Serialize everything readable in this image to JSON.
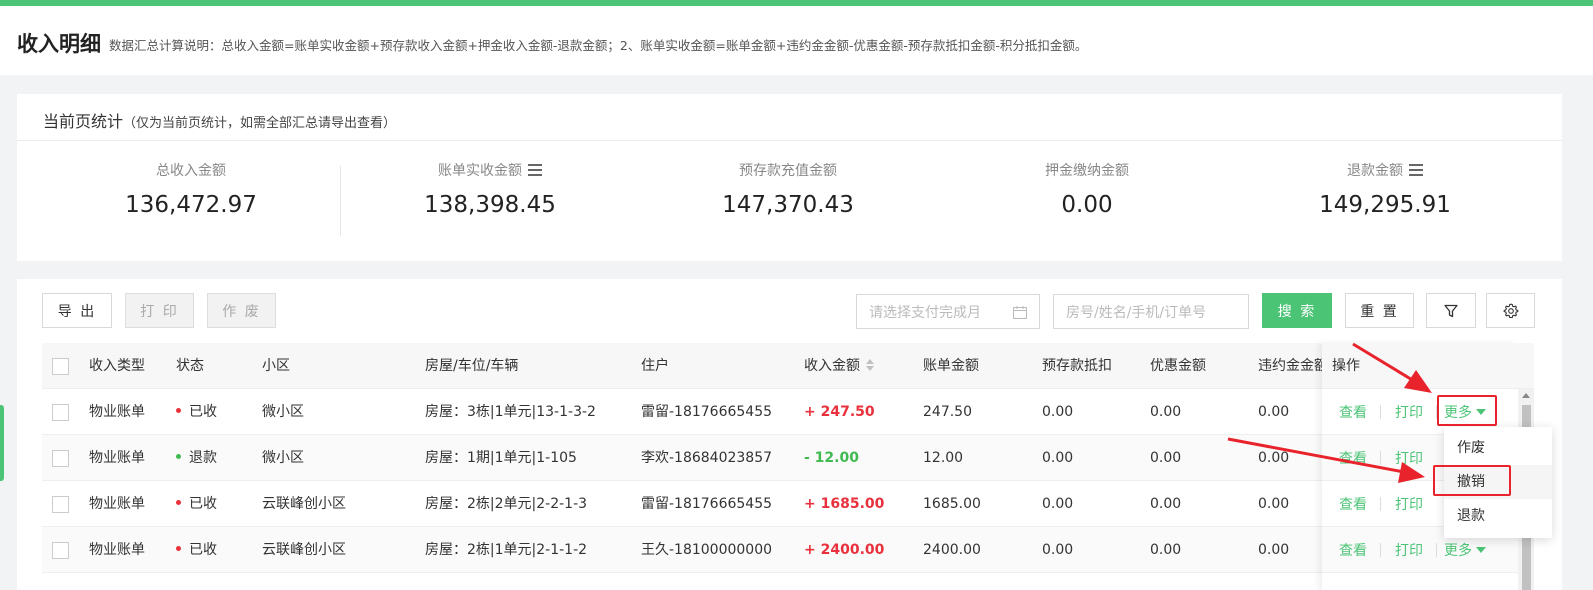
{
  "header": {
    "title": "收入明细",
    "description": "数据汇总计算说明：总收入金额=账单实收金额+预存款收入金额+押金收入金额-退款金额；2、账单实收金额=账单金额+违约金金额-优惠金额-预存款抵扣金额-积分抵扣金额。"
  },
  "stats": {
    "title": "当前页统计",
    "subtitle": "（仅为当前页统计，如需全部汇总请导出查看）",
    "items": [
      {
        "label": "总收入金额",
        "value": "136,472.97"
      },
      {
        "label": "账单实收金额",
        "value": "138,398.45"
      },
      {
        "label": "预存款充值金额",
        "value": "147,370.43"
      },
      {
        "label": "押金缴纳金额",
        "value": "0.00"
      },
      {
        "label": "退款金额",
        "value": "149,295.91"
      }
    ]
  },
  "toolbar": {
    "export": "导 出",
    "print": "打 印",
    "void": "作 废",
    "month_placeholder": "请选择支付完成月",
    "search_placeholder": "房号/姓名/手机/订单号",
    "search": "搜 索",
    "reset": "重 置"
  },
  "table": {
    "columns": [
      "收入类型",
      "状态",
      "小区",
      "房屋/车位/车辆",
      "住户",
      "收入金额",
      "账单金额",
      "预存款抵扣",
      "优惠金额",
      "违约金金额",
      "操作"
    ],
    "rows": [
      {
        "type": "物业账单",
        "status": "已收",
        "status_color": "#e8313c",
        "community": "微小区",
        "house": "房屋：3栋|1单元|13-1-3-2",
        "resident": "雷留-18176665455",
        "income": "+ 247.50",
        "income_color": "red",
        "bill": "247.50",
        "prepay": "0.00",
        "discount": "0.00",
        "penalty": "0.00"
      },
      {
        "type": "物业账单",
        "status": "退款",
        "status_color": "#3fb950",
        "community": "微小区",
        "house": "房屋：1期|1单元|1-105",
        "resident": "李欢-18684023857",
        "income": "- 12.00",
        "income_color": "green",
        "bill": "12.00",
        "prepay": "0.00",
        "discount": "0.00",
        "penalty": "0.00"
      },
      {
        "type": "物业账单",
        "status": "已收",
        "status_color": "#e8313c",
        "community": "云联峰创小区",
        "house": "房屋：2栋|2单元|2-2-1-3",
        "resident": "雷留-18176665455",
        "income": "+ 1685.00",
        "income_color": "red",
        "bill": "1685.00",
        "prepay": "0.00",
        "discount": "0.00",
        "penalty": "0.00"
      },
      {
        "type": "物业账单",
        "status": "已收",
        "status_color": "#e8313c",
        "community": "云联峰创小区",
        "house": "房屋：2栋|1单元|2-1-1-2",
        "resident": "王久-18100000000",
        "income": "+ 2400.00",
        "income_color": "red",
        "bill": "2400.00",
        "prepay": "0.00",
        "discount": "0.00",
        "penalty": "0.00"
      }
    ],
    "ops": {
      "view": "查看",
      "print": "打印",
      "more": "更多"
    }
  },
  "dropdown": {
    "items": [
      "作废",
      "撤销",
      "退款"
    ]
  },
  "colors": {
    "accent": "#4cc476",
    "danger": "#e8313c",
    "success": "#3fb950"
  }
}
